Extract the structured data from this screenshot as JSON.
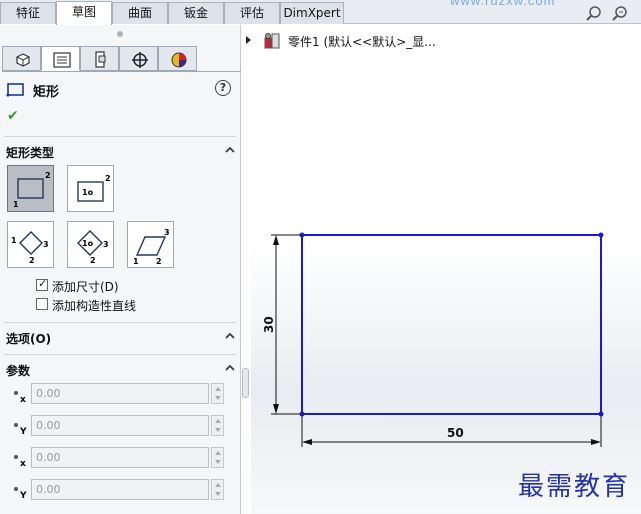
{
  "tabs": [
    {
      "label": "特征",
      "active": false
    },
    {
      "label": "草图",
      "active": true
    },
    {
      "label": "曲面",
      "active": false
    },
    {
      "label": "钣金",
      "active": false
    },
    {
      "label": "评估",
      "active": false
    },
    {
      "label": "DimXpert",
      "active": false
    }
  ],
  "watermark_url": "www.ruzxw.com",
  "property_manager": {
    "title": "矩形",
    "help": "?",
    "rect_type_header": "矩形类型",
    "add_dimensions": "添加尺寸(D)",
    "add_dimensions_checked": true,
    "add_construction": "添加构造性直线",
    "add_construction_checked": false,
    "options_header": "选项(O)",
    "params_header": "参数",
    "params": [
      {
        "axis": "x",
        "value": "0.00"
      },
      {
        "axis": "Y",
        "value": "0.00"
      },
      {
        "axis": "x",
        "value": "0.00"
      },
      {
        "axis": "Y",
        "value": "0.00"
      }
    ]
  },
  "tree": {
    "label": "零件1  (默认<<默认>_显..."
  },
  "sketch": {
    "height_dim": "30",
    "width_dim": "50",
    "line_color": "#1a1ad6"
  },
  "brand_text": "最需教育",
  "colors": {
    "accent_check": "#2e9b2e",
    "sketch_blue": "#1a1ad6"
  }
}
